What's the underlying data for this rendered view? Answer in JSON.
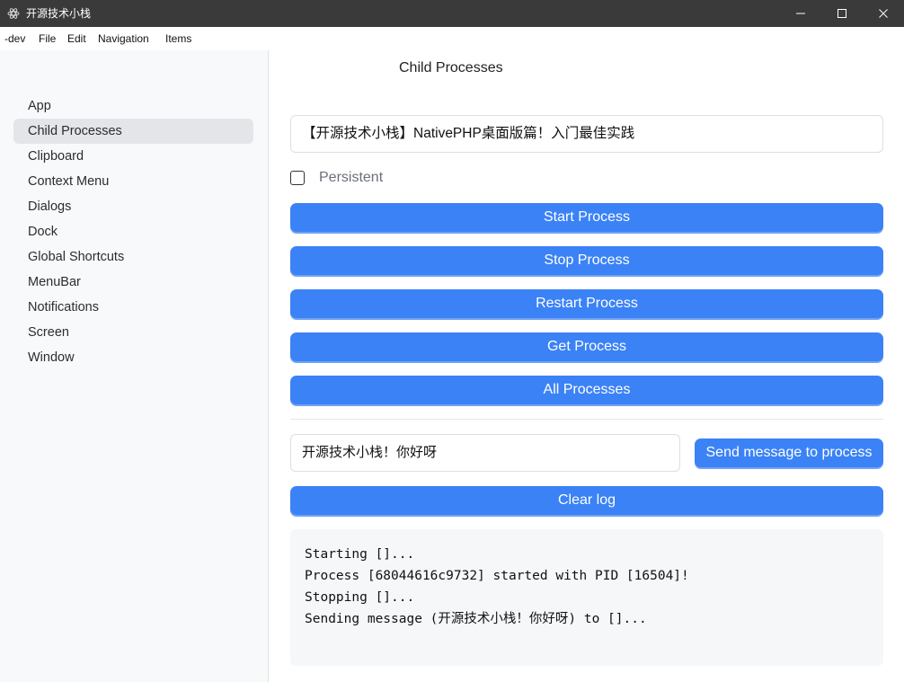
{
  "window": {
    "title": "开源技术小栈",
    "controls": {
      "minimize_icon": "minimize-icon",
      "maximize_icon": "maximize-icon",
      "close_icon": "close-icon"
    }
  },
  "menubar": {
    "items": [
      "-dev",
      "File",
      "Edit",
      "Navigation",
      "Items"
    ]
  },
  "sidebar": {
    "items": [
      {
        "label": "App",
        "active": false
      },
      {
        "label": "Child Processes",
        "active": true
      },
      {
        "label": "Clipboard",
        "active": false
      },
      {
        "label": "Context Menu",
        "active": false
      },
      {
        "label": "Dialogs",
        "active": false
      },
      {
        "label": "Dock",
        "active": false
      },
      {
        "label": "Global Shortcuts",
        "active": false
      },
      {
        "label": "MenuBar",
        "active": false
      },
      {
        "label": "Notifications",
        "active": false
      },
      {
        "label": "Screen",
        "active": false
      },
      {
        "label": "Window",
        "active": false
      }
    ]
  },
  "main": {
    "title": "Child Processes",
    "command_input": {
      "value": "【开源技术小栈】NativePHP桌面版篇！入门最佳实践"
    },
    "persistent": {
      "label": "Persistent",
      "checked": false
    },
    "buttons": {
      "start": "Start Process",
      "stop": "Stop Process",
      "restart": "Restart Process",
      "get": "Get Process",
      "all": "All Processes"
    },
    "message_input": {
      "value": "开源技术小栈！你好呀"
    },
    "send_button": "Send message to process",
    "clear_button": "Clear log",
    "log": [
      "Starting []...",
      "Process [68044616c9732] started with PID [16504]!",
      "Stopping []...",
      "Sending message (开源技术小栈！你好呀) to []..."
    ]
  },
  "colors": {
    "accent": "#3b82f6",
    "titlebar": "#3a3a3a",
    "sidebar_bg": "#f8f9fa",
    "active_item_bg": "#e3e5e8",
    "log_bg": "#f6f7f9"
  }
}
